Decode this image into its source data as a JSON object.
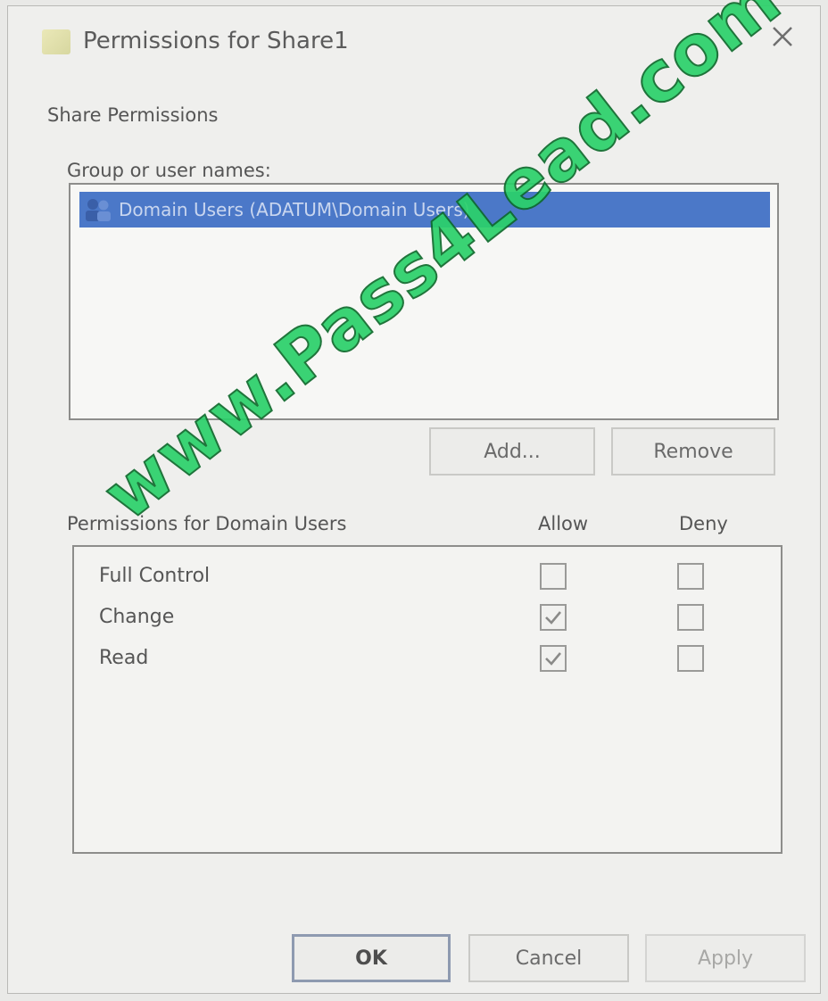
{
  "window": {
    "title": "Permissions for Share1",
    "close_label": "✕"
  },
  "share_permissions": {
    "section_label": "Share Permissions",
    "group_label": "Group or user names:",
    "users": [
      {
        "label": "Domain Users (ADATUM\\Domain Users)",
        "selected": true
      }
    ],
    "add_label": "Add...",
    "remove_label": "Remove"
  },
  "permissions": {
    "header": "Permissions for Domain Users",
    "allow_label": "Allow",
    "deny_label": "Deny",
    "rows": [
      {
        "name": "Full Control",
        "allow": false,
        "deny": false
      },
      {
        "name": "Change",
        "allow": true,
        "deny": false
      },
      {
        "name": "Read",
        "allow": true,
        "deny": false
      }
    ]
  },
  "footer": {
    "ok_label": "OK",
    "cancel_label": "Cancel",
    "apply_label": "Apply"
  },
  "watermark": {
    "text": "www.Pass4Lead.com"
  },
  "colors": {
    "selection": "#4b78c8",
    "watermark": "#2bd16a"
  }
}
